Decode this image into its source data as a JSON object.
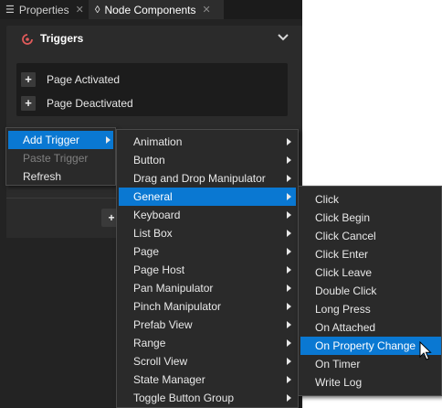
{
  "tabs": [
    {
      "label": "Properties"
    },
    {
      "label": "Node Components"
    }
  ],
  "section": {
    "title": "Triggers",
    "triggers": [
      "Page Activated",
      "Page Deactivated"
    ],
    "add_label": "+"
  },
  "context_menu": {
    "items": [
      {
        "label": "Add Trigger",
        "selected": true,
        "submenu": true
      },
      {
        "label": "Paste Trigger",
        "disabled": true
      },
      {
        "label": "Refresh"
      }
    ]
  },
  "categories_menu": {
    "items": [
      "Animation",
      "Button",
      "Drag and Drop Manipulator",
      "General",
      "Keyboard",
      "List Box",
      "Page",
      "Page Host",
      "Pan Manipulator",
      "Pinch Manipulator",
      "Prefab View",
      "Range",
      "Scroll View",
      "State Manager",
      "Toggle Button Group"
    ],
    "selected": "General"
  },
  "general_menu": {
    "items": [
      "Click",
      "Click Begin",
      "Click Cancel",
      "Click Enter",
      "Click Leave",
      "Double Click",
      "Long Press",
      "On Attached",
      "On Property Change",
      "On Timer",
      "Write Log"
    ],
    "selected": "On Property Change"
  },
  "colors": {
    "selection": "#0a78d2",
    "panel_bg": "#232323",
    "menu_bg": "#2a2a2a",
    "trigger_icon": "#e05a5a"
  }
}
